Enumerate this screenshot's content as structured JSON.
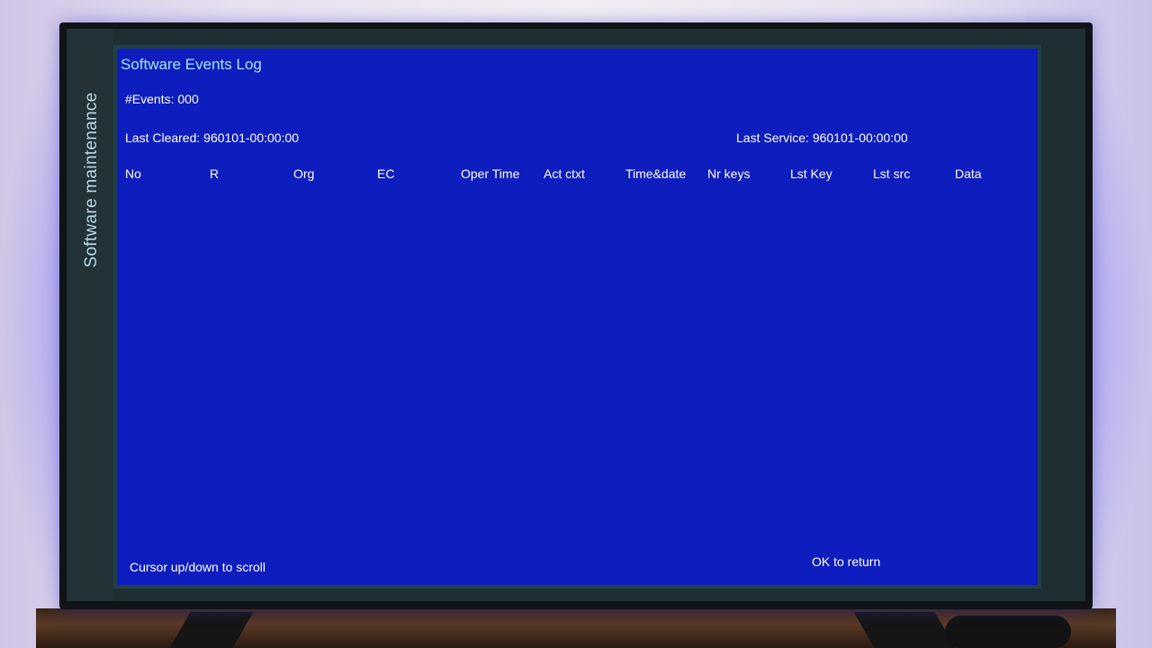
{
  "screen": {
    "side_title": "Software maintenance",
    "title": "Software Events Log",
    "events_count": "#Events: 000",
    "last_cleared": "Last Cleared: 960101-00:00:00",
    "last_service": "Last Service: 960101-00:00:00",
    "columns": [
      "No",
      "R",
      "Org",
      "EC",
      "Oper Time",
      "Act ctxt",
      "Time&date",
      "Nr keys",
      "Lst Key",
      "Lst src",
      "Data"
    ],
    "rows": [],
    "hint_scroll": "Cursor up/down to scroll",
    "hint_return": "OK to return"
  },
  "colors": {
    "panel_blue": "#0e1dbd",
    "title_cyan": "#a8e4ff",
    "side_title": "#b6d8e6",
    "text": "#ffffff"
  }
}
